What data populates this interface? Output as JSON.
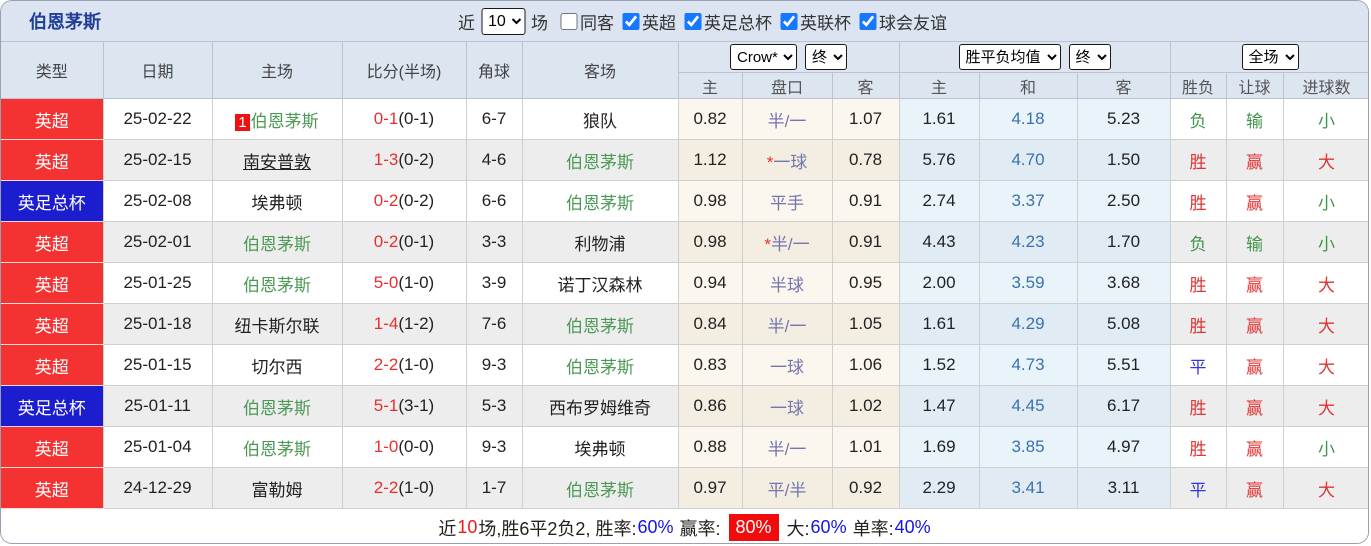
{
  "title": "伯恩茅斯",
  "toolbar": {
    "recent_label": "近",
    "matches_count": "10",
    "matches_label": "场",
    "checkboxes": [
      {
        "label": "同客",
        "checked": false
      },
      {
        "label": "英超",
        "checked": true
      },
      {
        "label": "英足总杯",
        "checked": true
      },
      {
        "label": "英联杯",
        "checked": true
      },
      {
        "label": "球会友谊",
        "checked": true
      }
    ]
  },
  "header": {
    "static_cols": [
      "类型",
      "日期",
      "主场",
      "比分(半场)",
      "角球",
      "客场"
    ],
    "odds_company_select": "Crow*",
    "odds_final_select": "终",
    "avg_select": "胜平负均值",
    "avg_final_select": "终",
    "fulltime_select": "全场",
    "sub_cols": [
      "主",
      "盘口",
      "客",
      "主",
      "和",
      "客",
      "胜负",
      "让球",
      "进球数"
    ]
  },
  "rows": [
    {
      "type": "英超",
      "type_color": "red",
      "date": "25-02-22",
      "home": "伯恩茅斯",
      "home_focus": true,
      "home_badge": "1",
      "home_underline": false,
      "score": "0-1",
      "half": "(0-1)",
      "corners": "6-7",
      "away": "狼队",
      "away_focus": false,
      "odds_home": "0.82",
      "handicap": "半/一",
      "handicap_star": false,
      "odds_away": "1.07",
      "avg_home": "1.61",
      "avg_draw": "4.18",
      "avg_away": "5.23",
      "result": "负",
      "result_color": "green",
      "let_result": "输",
      "let_color": "green",
      "goals": "小",
      "goals_color": "green"
    },
    {
      "type": "英超",
      "type_color": "red",
      "date": "25-02-15",
      "home": "南安普敦",
      "home_focus": false,
      "home_badge": "",
      "home_underline": true,
      "score": "1-3",
      "half": "(0-2)",
      "corners": "4-6",
      "away": "伯恩茅斯",
      "away_focus": true,
      "odds_home": "1.12",
      "handicap": "一球",
      "handicap_star": true,
      "odds_away": "0.78",
      "avg_home": "5.76",
      "avg_draw": "4.70",
      "avg_away": "1.50",
      "result": "胜",
      "result_color": "red",
      "let_result": "赢",
      "let_color": "red",
      "goals": "大",
      "goals_color": "red"
    },
    {
      "type": "英足总杯",
      "type_color": "blue",
      "date": "25-02-08",
      "home": "埃弗顿",
      "home_focus": false,
      "home_badge": "",
      "home_underline": false,
      "score": "0-2",
      "half": "(0-2)",
      "corners": "6-6",
      "away": "伯恩茅斯",
      "away_focus": true,
      "odds_home": "0.98",
      "handicap": "平手",
      "handicap_star": false,
      "odds_away": "0.91",
      "avg_home": "2.74",
      "avg_draw": "3.37",
      "avg_away": "2.50",
      "result": "胜",
      "result_color": "red",
      "let_result": "赢",
      "let_color": "red",
      "goals": "小",
      "goals_color": "green"
    },
    {
      "type": "英超",
      "type_color": "red",
      "date": "25-02-01",
      "home": "伯恩茅斯",
      "home_focus": true,
      "home_badge": "",
      "home_underline": false,
      "score": "0-2",
      "half": "(0-1)",
      "corners": "3-3",
      "away": "利物浦",
      "away_focus": false,
      "odds_home": "0.98",
      "handicap": "半/一",
      "handicap_star": true,
      "odds_away": "0.91",
      "avg_home": "4.43",
      "avg_draw": "4.23",
      "avg_away": "1.70",
      "result": "负",
      "result_color": "green",
      "let_result": "输",
      "let_color": "green",
      "goals": "小",
      "goals_color": "green"
    },
    {
      "type": "英超",
      "type_color": "red",
      "date": "25-01-25",
      "home": "伯恩茅斯",
      "home_focus": true,
      "home_badge": "",
      "home_underline": false,
      "score": "5-0",
      "half": "(1-0)",
      "corners": "3-9",
      "away": "诺丁汉森林",
      "away_focus": false,
      "odds_home": "0.94",
      "handicap": "半球",
      "handicap_star": false,
      "odds_away": "0.95",
      "avg_home": "2.00",
      "avg_draw": "3.59",
      "avg_away": "3.68",
      "result": "胜",
      "result_color": "red",
      "let_result": "赢",
      "let_color": "red",
      "goals": "大",
      "goals_color": "red"
    },
    {
      "type": "英超",
      "type_color": "red",
      "date": "25-01-18",
      "home": "纽卡斯尔联",
      "home_focus": false,
      "home_badge": "",
      "home_underline": false,
      "score": "1-4",
      "half": "(1-2)",
      "corners": "7-6",
      "away": "伯恩茅斯",
      "away_focus": true,
      "odds_home": "0.84",
      "handicap": "半/一",
      "handicap_star": false,
      "odds_away": "1.05",
      "avg_home": "1.61",
      "avg_draw": "4.29",
      "avg_away": "5.08",
      "result": "胜",
      "result_color": "red",
      "let_result": "赢",
      "let_color": "red",
      "goals": "大",
      "goals_color": "red"
    },
    {
      "type": "英超",
      "type_color": "red",
      "date": "25-01-15",
      "home": "切尔西",
      "home_focus": false,
      "home_badge": "",
      "home_underline": false,
      "score": "2-2",
      "half": "(1-0)",
      "corners": "9-3",
      "away": "伯恩茅斯",
      "away_focus": true,
      "odds_home": "0.83",
      "handicap": "一球",
      "handicap_star": false,
      "odds_away": "1.06",
      "avg_home": "1.52",
      "avg_draw": "4.73",
      "avg_away": "5.51",
      "result": "平",
      "result_color": "blue",
      "let_result": "赢",
      "let_color": "red",
      "goals": "大",
      "goals_color": "red"
    },
    {
      "type": "英足总杯",
      "type_color": "blue",
      "date": "25-01-11",
      "home": "伯恩茅斯",
      "home_focus": true,
      "home_badge": "",
      "home_underline": false,
      "score": "5-1",
      "half": "(3-1)",
      "corners": "5-3",
      "away": "西布罗姆维奇",
      "away_focus": false,
      "odds_home": "0.86",
      "handicap": "一球",
      "handicap_star": false,
      "odds_away": "1.02",
      "avg_home": "1.47",
      "avg_draw": "4.45",
      "avg_away": "6.17",
      "result": "胜",
      "result_color": "red",
      "let_result": "赢",
      "let_color": "red",
      "goals": "大",
      "goals_color": "red"
    },
    {
      "type": "英超",
      "type_color": "red",
      "date": "25-01-04",
      "home": "伯恩茅斯",
      "home_focus": true,
      "home_badge": "",
      "home_underline": false,
      "score": "1-0",
      "half": "(0-0)",
      "corners": "9-3",
      "away": "埃弗顿",
      "away_focus": false,
      "odds_home": "0.88",
      "handicap": "半/一",
      "handicap_star": false,
      "odds_away": "1.01",
      "avg_home": "1.69",
      "avg_draw": "3.85",
      "avg_away": "4.97",
      "result": "胜",
      "result_color": "red",
      "let_result": "赢",
      "let_color": "red",
      "goals": "小",
      "goals_color": "green"
    },
    {
      "type": "英超",
      "type_color": "red",
      "date": "24-12-29",
      "home": "富勒姆",
      "home_focus": false,
      "home_badge": "",
      "home_underline": false,
      "score": "2-2",
      "half": "(1-0)",
      "corners": "1-7",
      "away": "伯恩茅斯",
      "away_focus": true,
      "odds_home": "0.97",
      "handicap": "平/半",
      "handicap_star": false,
      "odds_away": "0.92",
      "avg_home": "2.29",
      "avg_draw": "3.41",
      "avg_away": "3.11",
      "result": "平",
      "result_color": "blue",
      "let_result": "赢",
      "let_color": "red",
      "goals": "大",
      "goals_color": "red"
    }
  ],
  "summary": {
    "segments": [
      {
        "text": "近",
        "style": "plain"
      },
      {
        "text": "10",
        "style": "red"
      },
      {
        "text": "场,胜6平2负2, 胜率:",
        "style": "plain"
      },
      {
        "text": "60%",
        "style": "blue"
      },
      {
        "text": " 赢率: ",
        "style": "plain"
      },
      {
        "text": "80%",
        "style": "badge"
      },
      {
        "text": " 大:",
        "style": "plain"
      },
      {
        "text": "60%",
        "style": "blue"
      },
      {
        "text": " 单率:",
        "style": "plain"
      },
      {
        "text": "40%",
        "style": "blue"
      }
    ]
  },
  "colors": {
    "league_red": "#f43232",
    "cup_blue": "#1d1dd0",
    "focus_team_green": "#4d9a57",
    "score_red": "#e92f2f",
    "handicap_slate": "#7575ae",
    "avg_draw_blue": "#3a72ae",
    "win_red": "#e23434",
    "lose_green": "#3f9449",
    "draw_blue": "#3434e0",
    "checkbox_blue": "#1677ff",
    "titlebar_bg": "#dbe4f0",
    "header_bg": "#dce5f0",
    "crow_col_bg": "#fbf7ee",
    "avg_col_bg": "#e9f3fa",
    "badge_red": "#f00c0c"
  }
}
